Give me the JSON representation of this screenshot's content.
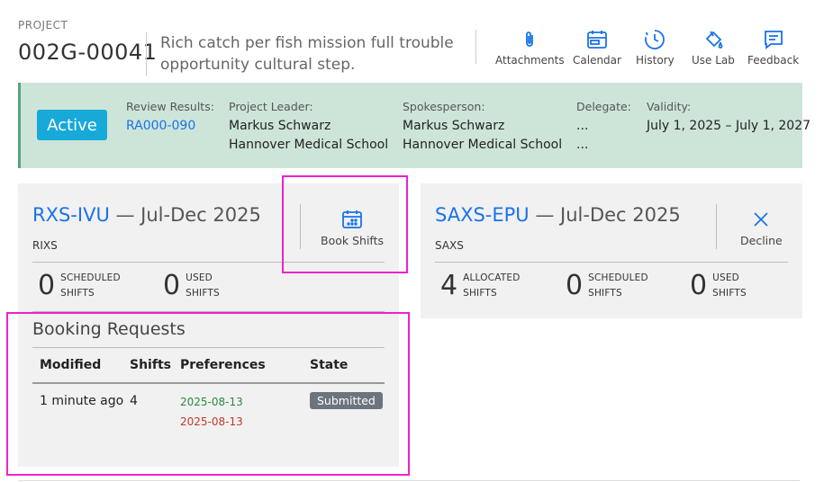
{
  "project": {
    "label": "PROJECT",
    "id": "002G-00041",
    "title": "Rich catch per fish mission full trouble opportunity cultural step."
  },
  "toolbar": {
    "items": [
      {
        "label": "Attachments",
        "icon": "paperclip-icon"
      },
      {
        "label": "Calendar",
        "icon": "calendar-icon"
      },
      {
        "label": "History",
        "icon": "history-icon"
      },
      {
        "label": "Use Lab",
        "icon": "paint-bucket-icon"
      },
      {
        "label": "Feedback",
        "icon": "feedback-icon"
      }
    ]
  },
  "status": {
    "badge": "Active",
    "review_results": {
      "label": "Review Results:",
      "value": "RA000-090"
    },
    "project_leader": {
      "label": "Project Leader:",
      "name": "Markus Schwarz",
      "org": "Hannover Medical School"
    },
    "spokesperson": {
      "label": "Spokesperson:",
      "name": "Markus Schwarz",
      "org": "Hannover Medical School"
    },
    "delegate": {
      "label": "Delegate:",
      "name": "...",
      "org": "..."
    },
    "validity": {
      "label": "Validity:",
      "value": "July 1, 2025 – July 1, 2027"
    }
  },
  "card_left": {
    "code": "RXS-IVU",
    "period": " — Jul-Dec 2025",
    "subtitle": "RIXS",
    "action": "Book Shifts",
    "stats": [
      {
        "value": "0",
        "line1": "SCHEDULED",
        "line2": "SHIFTS"
      },
      {
        "value": "0",
        "line1": "USED",
        "line2": "SHIFTS"
      }
    ],
    "booking": {
      "title": "Booking Requests",
      "headers": [
        "Modified",
        "Shifts",
        "Preferences",
        "State"
      ],
      "rows": [
        {
          "modified": "1 minute ago",
          "shifts": "4",
          "pref1": "2025-08-13",
          "pref2": "2025-08-13",
          "state": "Submitted"
        }
      ]
    }
  },
  "card_right": {
    "code": "SAXS-EPU",
    "period": " — Jul-Dec 2025",
    "subtitle": "SAXS",
    "action": "Decline",
    "stats": [
      {
        "value": "4",
        "line1": "ALLOCATED",
        "line2": "SHIFTS"
      },
      {
        "value": "0",
        "line1": "SCHEDULED",
        "line2": "SHIFTS"
      },
      {
        "value": "0",
        "line1": "USED",
        "line2": "SHIFTS"
      }
    ]
  },
  "colors": {
    "accent": "#1a73e8",
    "active_badge": "#17a9d8",
    "status_band": "#cde5d9",
    "highlight": "#ee22cc",
    "submitted_badge": "#6c757d"
  }
}
